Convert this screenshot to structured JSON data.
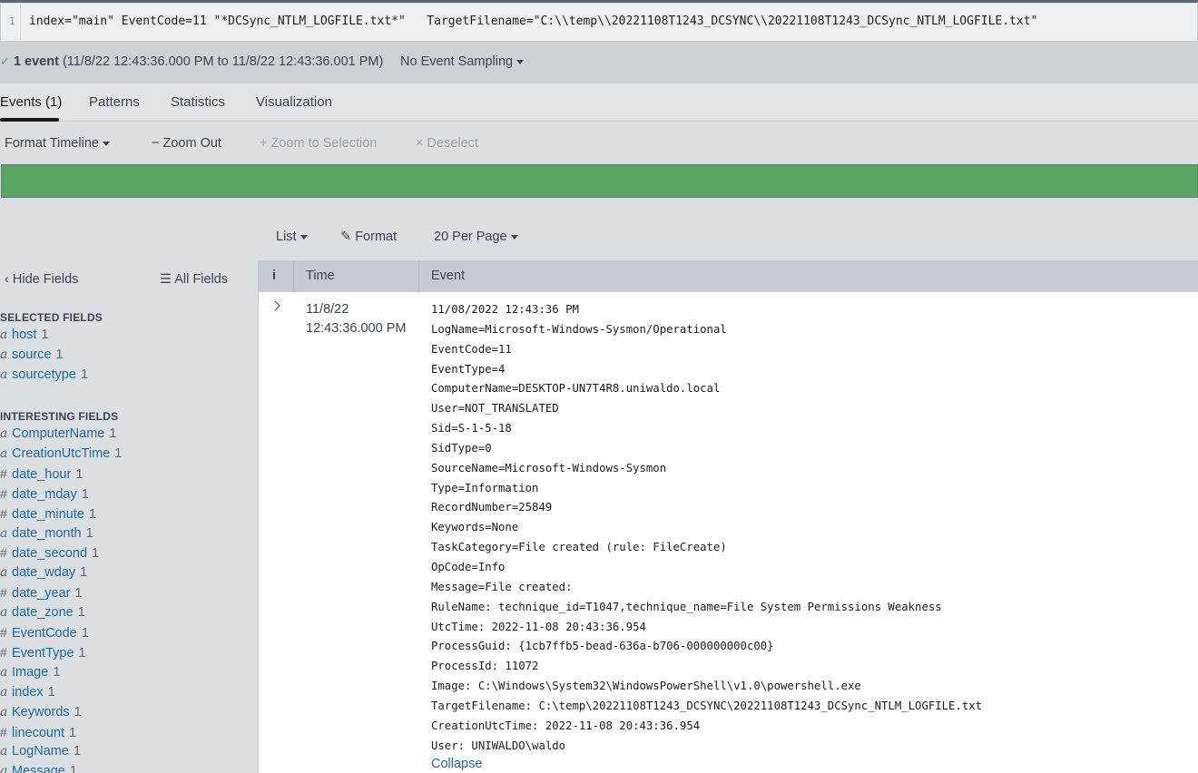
{
  "search": {
    "line_number": "1",
    "query": "index=\"main\" EventCode=11 \"*DCSync_NTLM_LOGFILE.txt*\"   TargetFilename=\"C:\\\\temp\\\\20221108T1243_DCSYNC\\\\20221108T1243_DCSync_NTLM_LOGFILE.txt\""
  },
  "status": {
    "check": "✓",
    "count": "1 event",
    "range": "(11/8/22 12:43:36.000 PM to 11/8/22 12:43:36.001 PM)",
    "sampling": "No Event Sampling"
  },
  "tabs": [
    {
      "label": "Events (1)"
    },
    {
      "label": "Patterns"
    },
    {
      "label": "Statistics"
    },
    {
      "label": "Visualization"
    }
  ],
  "timeline": {
    "format": "Format Timeline",
    "zoom_out": "Zoom Out",
    "zoom_selection": "Zoom to Selection",
    "deselect": "Deselect",
    "bar_color": "#5aa463"
  },
  "results_toolbar": {
    "list": "List",
    "format": "Format",
    "per_page": "20 Per Page"
  },
  "sidebar": {
    "hide_fields": "Hide Fields",
    "all_fields": "All Fields",
    "selected_title": "SELECTED FIELDS",
    "selected": [
      {
        "type": "a",
        "name": "host",
        "count": "1"
      },
      {
        "type": "a",
        "name": "source",
        "count": "1"
      },
      {
        "type": "a",
        "name": "sourcetype",
        "count": "1"
      }
    ],
    "interesting_title": "INTERESTING FIELDS",
    "interesting": [
      {
        "type": "a",
        "name": "ComputerName",
        "count": "1"
      },
      {
        "type": "a",
        "name": "CreationUtcTime",
        "count": "1"
      },
      {
        "type": "#",
        "name": "date_hour",
        "count": "1"
      },
      {
        "type": "#",
        "name": "date_mday",
        "count": "1"
      },
      {
        "type": "#",
        "name": "date_minute",
        "count": "1"
      },
      {
        "type": "a",
        "name": "date_month",
        "count": "1"
      },
      {
        "type": "#",
        "name": "date_second",
        "count": "1"
      },
      {
        "type": "a",
        "name": "date_wday",
        "count": "1"
      },
      {
        "type": "#",
        "name": "date_year",
        "count": "1"
      },
      {
        "type": "a",
        "name": "date_zone",
        "count": "1"
      },
      {
        "type": "#",
        "name": "EventCode",
        "count": "1"
      },
      {
        "type": "#",
        "name": "EventType",
        "count": "1"
      },
      {
        "type": "a",
        "name": "Image",
        "count": "1"
      },
      {
        "type": "a",
        "name": "index",
        "count": "1"
      },
      {
        "type": "a",
        "name": "Keywords",
        "count": "1"
      },
      {
        "type": "#",
        "name": "linecount",
        "count": "1"
      },
      {
        "type": "a",
        "name": "LogName",
        "count": "1"
      },
      {
        "type": "a",
        "name": "Message",
        "count": "1"
      }
    ]
  },
  "table": {
    "info_header": "i",
    "time_header": "Time",
    "event_header": "Event",
    "row": {
      "date": "11/8/22",
      "time": "12:43:36.000 PM",
      "lines": [
        "11/08/2022 12:43:36 PM",
        "LogName=Microsoft-Windows-Sysmon/Operational",
        "EventCode=11",
        "EventType=4",
        "ComputerName=DESKTOP-UN7T4R8.uniwaldo.local",
        "User=NOT_TRANSLATED",
        "Sid=S-1-5-18",
        "SidType=0",
        "SourceName=Microsoft-Windows-Sysmon",
        "Type=Information",
        "RecordNumber=25849",
        "Keywords=None",
        "TaskCategory=File created (rule: FileCreate)",
        "OpCode=Info",
        "Message=File created:",
        "RuleName: technique_id=T1047,technique_name=File System Permissions Weakness",
        "UtcTime: 2022-11-08 20:43:36.954",
        "ProcessGuid: {1cb7ffb5-bead-636a-b706-000000000c00}",
        "ProcessId: 11072",
        "Image: C:\\Windows\\System32\\WindowsPowerShell\\v1.0\\powershell.exe",
        "TargetFilename: C:\\temp\\20221108T1243_DCSYNC\\20221108T1243_DCSync_NTLM_LOGFILE.txt",
        "CreationUtcTime: 2022-11-08 20:43:36.954",
        "User: UNIWALDO\\waldo"
      ],
      "collapse": "Collapse"
    }
  }
}
